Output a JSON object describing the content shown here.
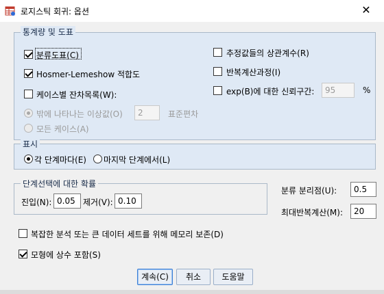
{
  "window": {
    "title": "로지스틱 회귀: 옵션",
    "close_glyph": "✕",
    "app_icon": "spss-table-icon"
  },
  "stats": {
    "group_label": "통계량 및 도표",
    "classification_plot": {
      "label": "분류도표(C)",
      "checked": true
    },
    "hosmer": {
      "label": "Hosmer-Lemeshow 적합도",
      "checked": true
    },
    "casewise": {
      "label": "케이스별 잔차목록(W):",
      "checked": false
    },
    "outliers": {
      "label": "밖에 나타나는 이상값(O)",
      "value": "2",
      "unit": "표준편차",
      "checked": true,
      "enabled": false
    },
    "all_cases": {
      "label": "모든 케이스(A)",
      "checked": false,
      "enabled": false
    },
    "correlations": {
      "label": "추정값들의 상관계수(R)",
      "checked": false
    },
    "iteration_history": {
      "label": "반복계산과정(I)",
      "checked": false
    },
    "ci_exp": {
      "label": "exp(B)에 대한 신뢰구간:",
      "value": "95",
      "unit": "%",
      "checked": false
    }
  },
  "display": {
    "group_label": "표시",
    "each_step": {
      "label": "각 단계마다(E)",
      "checked": true
    },
    "last_step": {
      "label": "마지막 단계에서(L)",
      "checked": false
    }
  },
  "stepwise": {
    "group_label": "단계선택에 대한 확률",
    "entry_label": "진입(N):",
    "entry_value": "0.05",
    "removal_label": "제거(V):",
    "removal_value": "0.10"
  },
  "classification_cutoff": {
    "label": "분류 분리점(U):",
    "value": "0.5"
  },
  "max_iterations": {
    "label": "최대반복계산(M):",
    "value": "20"
  },
  "conserve_memory": {
    "label": "복잡한 분석 또는 큰 데이터 세트를 위해 메모리 보존(D)",
    "checked": false
  },
  "include_constant": {
    "label": "모형에 상수 포함(S)",
    "checked": true
  },
  "buttons": {
    "continue": "계속(C)",
    "cancel": "취소",
    "help": "도움말"
  }
}
